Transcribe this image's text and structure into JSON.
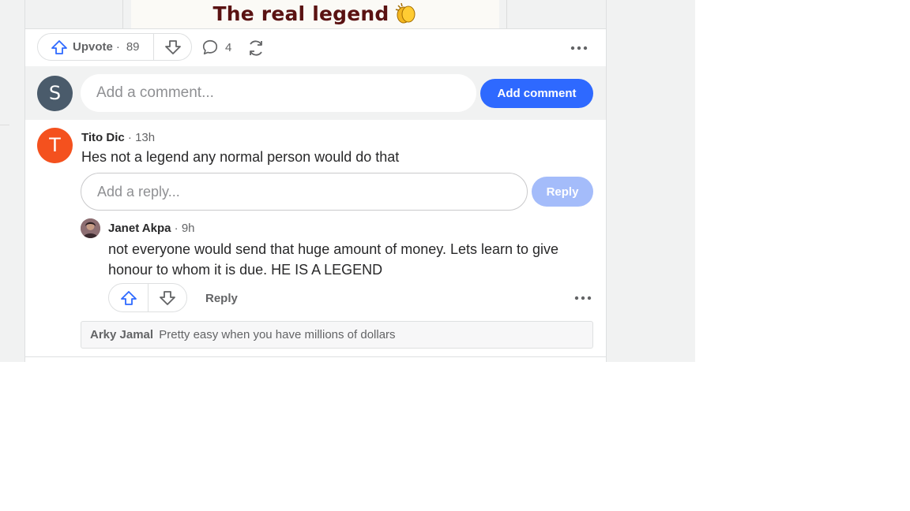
{
  "post": {
    "image_caption": "The real legend",
    "image_caption_emoji": "clapping-hands"
  },
  "actions": {
    "upvote_label": "Upvote",
    "upvote_separator": "·",
    "upvote_count": "89",
    "comment_count": "4",
    "icons": [
      "upvote-icon",
      "downvote-icon",
      "comment-icon",
      "share-icon",
      "more-options-icon"
    ]
  },
  "add_comment": {
    "avatar_letter": "S",
    "placeholder": "Add a comment...",
    "button_label": "Add comment"
  },
  "comment": {
    "avatar_letter": "T",
    "author": "Tito Dic",
    "time": " · 13h",
    "body": "Hes not a legend any normal person would do that",
    "reply_placeholder": "Add a reply...",
    "reply_button": "Reply"
  },
  "reply": {
    "author": "Janet Akpa",
    "time": " · 9h",
    "body": "not everyone would send that huge amount of money. Lets learn to give honour to whom it is due. HE IS A LEGEND",
    "reply_label": "Reply"
  },
  "collapsed_reply": {
    "author": "Arky Jamal",
    "text": "Pretty easy when you have millions of dollars"
  },
  "colors": {
    "accent": "#2e69ff",
    "accent_disabled": "#a4bcfa",
    "avatar_s": "#4a5b6b",
    "avatar_t": "#f4511e",
    "muted_text": "#636466",
    "page_bg": "#f1f2f2"
  }
}
